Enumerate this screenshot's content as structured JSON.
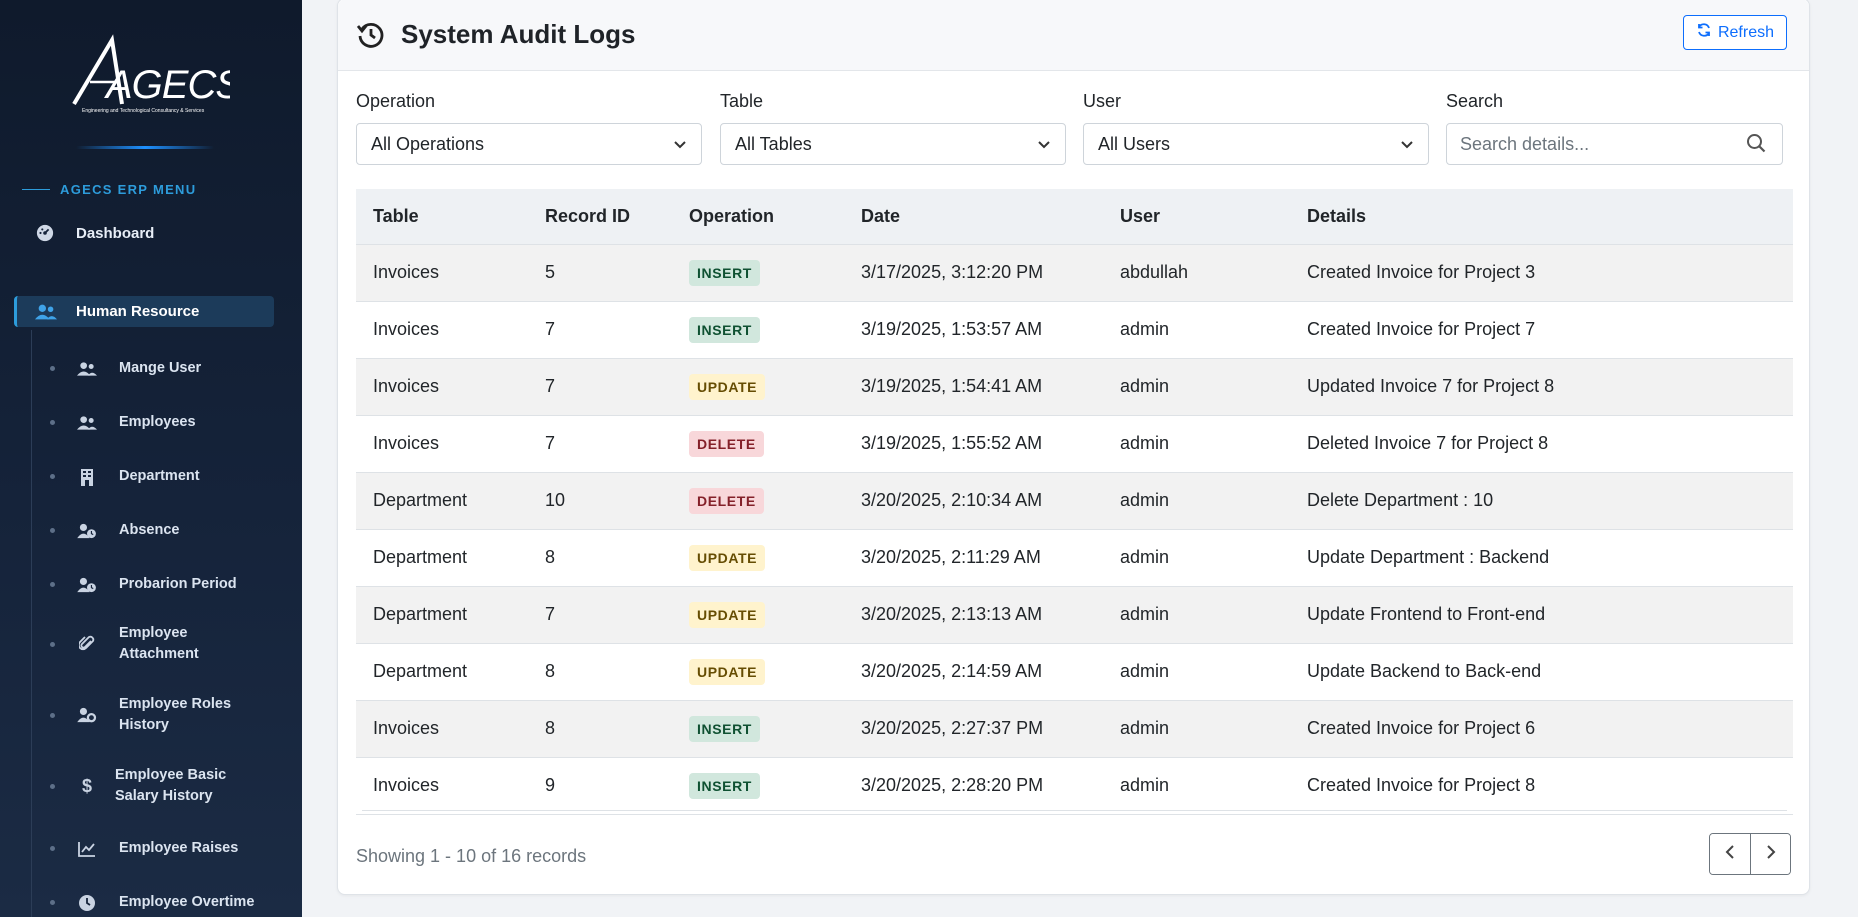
{
  "sidebar": {
    "logo_text": "AGECS",
    "logo_tagline": "Engineering and Technological Consultancy & Services",
    "menu_heading": "AGECS ERP MENU",
    "dashboard": {
      "label": "Dashboard",
      "icon": "gauge-icon"
    },
    "section": {
      "label": "Human Resource",
      "icon": "users-icon"
    },
    "items": [
      {
        "label": "Mange User",
        "icon": "users-icon"
      },
      {
        "label": "Employees",
        "icon": "users-icon"
      },
      {
        "label": "Department",
        "icon": "building-icon"
      },
      {
        "label": "Absence",
        "icon": "user-clock-icon"
      },
      {
        "label": "Probarion Period",
        "icon": "user-clock-icon"
      },
      {
        "label": "Employee Attachment",
        "icon": "paperclip-icon"
      },
      {
        "label": "Employee Roles History",
        "icon": "user-gear-icon"
      },
      {
        "label": "Employee Basic Salary History",
        "icon": "dollar-icon"
      },
      {
        "label": "Employee Raises",
        "icon": "chart-line-icon"
      },
      {
        "label": "Employee Overtime",
        "icon": "clock-icon"
      }
    ]
  },
  "header": {
    "title": "System Audit Logs",
    "refresh_label": "Refresh"
  },
  "filters": {
    "operation": {
      "label": "Operation",
      "value": "All Operations"
    },
    "table": {
      "label": "Table",
      "value": "All Tables"
    },
    "user": {
      "label": "User",
      "value": "All Users"
    },
    "search": {
      "label": "Search",
      "placeholder": "Search details..."
    }
  },
  "table": {
    "columns": [
      "Table",
      "Record ID",
      "Operation",
      "Date",
      "User",
      "Details"
    ],
    "rows": [
      [
        "Invoices",
        "5",
        "INSERT",
        "3/17/2025, 3:12:20 PM",
        "abdullah",
        "Created Invoice for Project 3"
      ],
      [
        "Invoices",
        "7",
        "INSERT",
        "3/19/2025, 1:53:57 AM",
        "admin",
        "Created Invoice for Project 7"
      ],
      [
        "Invoices",
        "7",
        "UPDATE",
        "3/19/2025, 1:54:41 AM",
        "admin",
        "Updated Invoice 7 for Project 8"
      ],
      [
        "Invoices",
        "7",
        "DELETE",
        "3/19/2025, 1:55:52 AM",
        "admin",
        "Deleted Invoice 7 for Project 8"
      ],
      [
        "Department",
        "10",
        "DELETE",
        "3/20/2025, 2:10:34 AM",
        "admin",
        "Delete Department : 10"
      ],
      [
        "Department",
        "8",
        "UPDATE",
        "3/20/2025, 2:11:29 AM",
        "admin",
        "Update Department : Backend"
      ],
      [
        "Department",
        "7",
        "UPDATE",
        "3/20/2025, 2:13:13 AM",
        "admin",
        "Update Frontend to Front-end"
      ],
      [
        "Department",
        "8",
        "UPDATE",
        "3/20/2025, 2:14:59 AM",
        "admin",
        "Update Backend to Back-end"
      ],
      [
        "Invoices",
        "8",
        "INSERT",
        "3/20/2025, 2:27:37 PM",
        "admin",
        "Created Invoice for Project 6"
      ],
      [
        "Invoices",
        "9",
        "INSERT",
        "3/20/2025, 2:28:20 PM",
        "admin",
        "Created Invoice for Project 8"
      ]
    ]
  },
  "pagination": {
    "summary": "Showing 1 - 10 of 16 records"
  },
  "colors": {
    "accent": "#0d6efd",
    "sidebar_bg": "#0f1a2c",
    "insert_bg": "#d1e7dd",
    "update_bg": "#fff3cd",
    "delete_bg": "#f8d7da"
  }
}
